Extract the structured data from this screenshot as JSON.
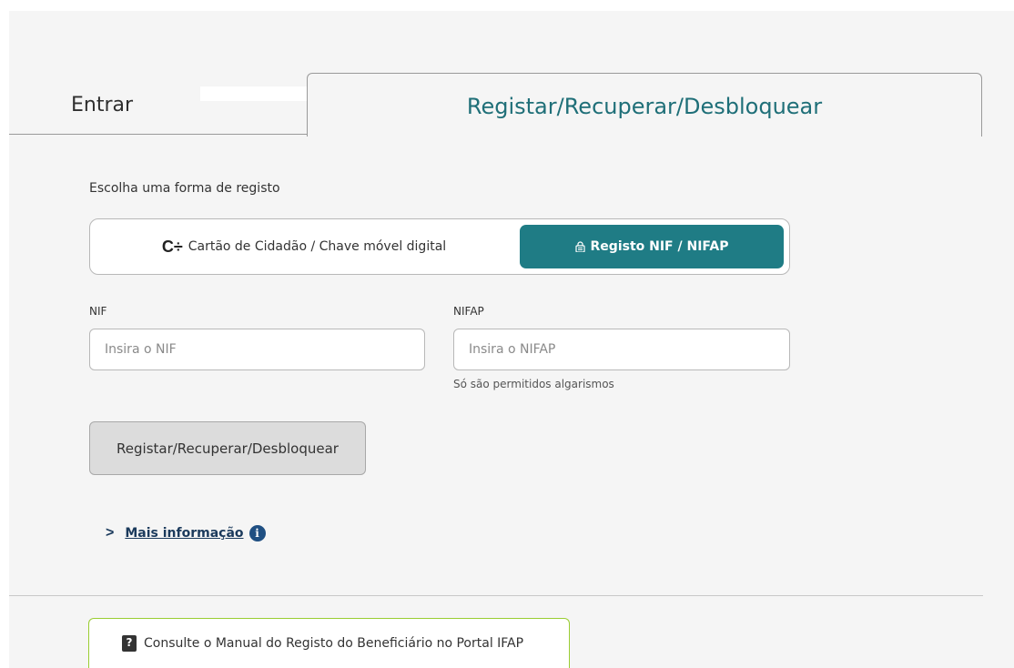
{
  "tabs": {
    "entrar": "Entrar",
    "registar": "Registar/Recuperar/Desbloquear"
  },
  "form": {
    "choose_text": "Escolha uma forma de registo",
    "options": {
      "cartao": "Cartão de Cidadão / Chave móvel digital",
      "nif": "Registo NIF / NIFAP"
    },
    "nif": {
      "label": "NIF",
      "placeholder": "Insira o NIF",
      "value": ""
    },
    "nifap": {
      "label": "NIFAP",
      "placeholder": "Insira o NIFAP",
      "value": "",
      "hint": "Só são permitidos algarismos"
    },
    "submit_label": "Registar/Recuperar/Desbloquear"
  },
  "more_info": {
    "label": "Mais informação",
    "icon": "info-icon"
  },
  "manual": {
    "label": "Consulte o Manual do Registo do Beneficiário no Portal IFAP",
    "icon": "help-book-icon"
  },
  "colors": {
    "accent": "#1f7c85",
    "tab_title": "#1f6f78",
    "link": "#1b3a5c",
    "manual_border": "#9acd32"
  }
}
